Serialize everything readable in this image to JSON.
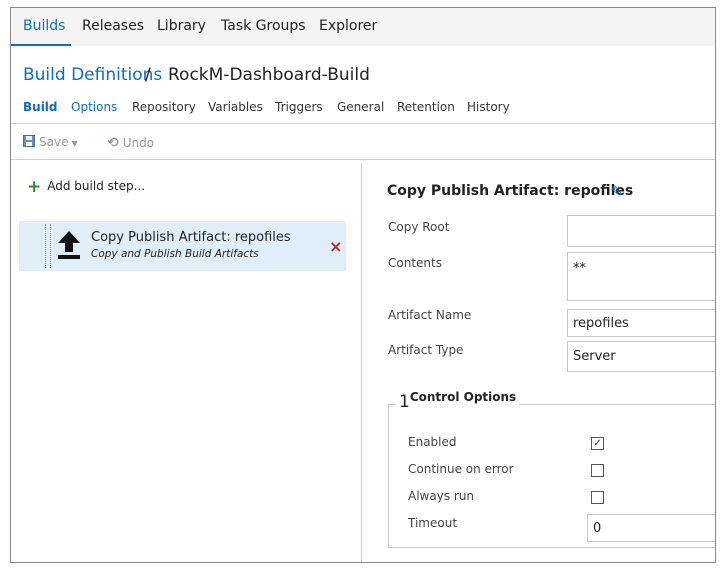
{
  "hub_tabs": [
    "Builds",
    "Releases",
    "Library",
    "Task Groups",
    "Explorer"
  ],
  "breadcrumb": {
    "link": "Build Definitions",
    "separator": "/",
    "title": "RockM-Dashboard-Build"
  },
  "definition_tabs": [
    "Build",
    "Options",
    "Repository",
    "Variables",
    "Triggers",
    "General",
    "Retention",
    "History"
  ],
  "toolbar": {
    "save_label": "Save",
    "undo_label": "Undo"
  },
  "add_step_label": "Add build step...",
  "step": {
    "title": "Copy Publish Artifact: repofiles",
    "subtitle": "Copy and Publish Build Artifacts",
    "remove_glyph": "×"
  },
  "panel": {
    "title": "Copy Publish Artifact: repofiles",
    "copy_root_label": "Copy Root",
    "copy_root_value": "",
    "contents_label": "Contents",
    "contents_value": "**",
    "artifact_name_label": "Artifact Name",
    "artifact_name_value": "repofiles",
    "artifact_type_label": "Artifact Type",
    "artifact_type_value": "Server"
  },
  "control_options": {
    "number": "1",
    "title": "Control Options",
    "enabled_label": "Enabled",
    "enabled_checked": true,
    "continue_label": "Continue on error",
    "continue_checked": false,
    "always_run_label": "Always run",
    "always_run_checked": false,
    "timeout_label": "Timeout",
    "timeout_value": "0"
  },
  "colors": {
    "accent": "#106ebe",
    "selected_step": "#dfeef9",
    "remove": "#c0272d",
    "add": "#2c8a2c"
  },
  "icons": [
    "upload-icon",
    "save-icon",
    "undo-icon",
    "plus-icon",
    "pencil-icon",
    "close-icon"
  ]
}
